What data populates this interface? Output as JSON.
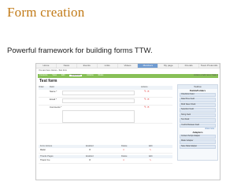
{
  "slide": {
    "title": "Form creation",
    "subtitle": "Powerful framework for building forms TTW."
  },
  "app": {
    "nav": [
      "Home",
      "News",
      "Events",
      "Links",
      "Videos",
      "Members",
      "My page",
      "Friends",
      "Team Protocolls"
    ],
    "breadcrumb": "You are here: Home › Test form",
    "action_tabs": [
      "Contents",
      "View",
      "Edit",
      "Questions",
      "Actions",
      "Rules"
    ],
    "tools": "Actions ▾  Add new ▾  State ▾",
    "page_title": "Test form",
    "table_headers": {
      "order": "Order",
      "field": "Field",
      "actions": "Actions"
    },
    "rows": [
      {
        "label": "Name *"
      },
      {
        "label": "Email *"
      },
      {
        "label": "Comments *"
      }
    ],
    "panel": {
      "title": "Toolbox",
      "fields_title": "Fields/Folders",
      "fields": [
        "Checkbox Field",
        "Date/Time Field",
        "Multi Select Field",
        "Selection Field",
        "String Field",
        "Text Field",
        "Yes/No Boolean Field"
      ],
      "more": "show more...",
      "adapters_title": "Adapters",
      "adapters": [
        "Content Script Adapter",
        "Mailer Adapter",
        "Save Data Adapter"
      ]
    },
    "adapters_table": {
      "headers": [
        "Form Actions",
        "Enabled",
        "Delete",
        "Edit"
      ],
      "rows": [
        "Mailer"
      ]
    },
    "thanks_table": {
      "headers": [
        "Thanks Pages",
        "Enabled",
        "Delete",
        "Edit"
      ],
      "rows": [
        "Thank You"
      ]
    }
  }
}
